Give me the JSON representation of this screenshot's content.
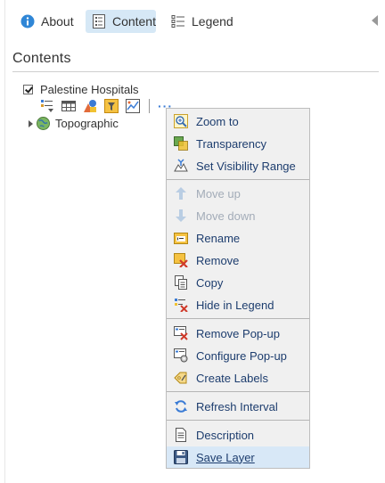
{
  "tabs": {
    "about_label": "About",
    "content_label": "Content",
    "legend_label": "Legend"
  },
  "section_title": "Contents",
  "layer": {
    "name": "Palestine Hospitals",
    "checked": true
  },
  "basemap": {
    "name": "Topographic"
  },
  "menu": {
    "items": [
      {
        "label": "Zoom to",
        "icon": "zoom-to-icon"
      },
      {
        "label": "Transparency",
        "icon": "transparency-icon"
      },
      {
        "label": "Set Visibility Range",
        "icon": "visibility-range-icon"
      },
      {
        "label": "Move up",
        "icon": "arrow-up-icon",
        "disabled": true
      },
      {
        "label": "Move down",
        "icon": "arrow-down-icon",
        "disabled": true
      },
      {
        "label": "Rename",
        "icon": "rename-icon"
      },
      {
        "label": "Remove",
        "icon": "remove-icon"
      },
      {
        "label": "Copy",
        "icon": "copy-icon"
      },
      {
        "label": "Hide in Legend",
        "icon": "hide-legend-icon"
      },
      {
        "label": "Remove Pop-up",
        "icon": "remove-popup-icon"
      },
      {
        "label": "Configure Pop-up",
        "icon": "configure-popup-icon"
      },
      {
        "label": "Create Labels",
        "icon": "create-labels-icon"
      },
      {
        "label": "Refresh Interval",
        "icon": "refresh-icon"
      },
      {
        "label": "Description",
        "icon": "description-icon"
      },
      {
        "label": "Save Layer",
        "icon": "save-icon",
        "highlighted": true
      }
    ]
  },
  "colors": {
    "tab_active_bg": "#d6e8f6",
    "menu_bg": "#f0f0f0",
    "menu_text": "#1d3d6e",
    "accent_blue": "#3a7bd5"
  }
}
